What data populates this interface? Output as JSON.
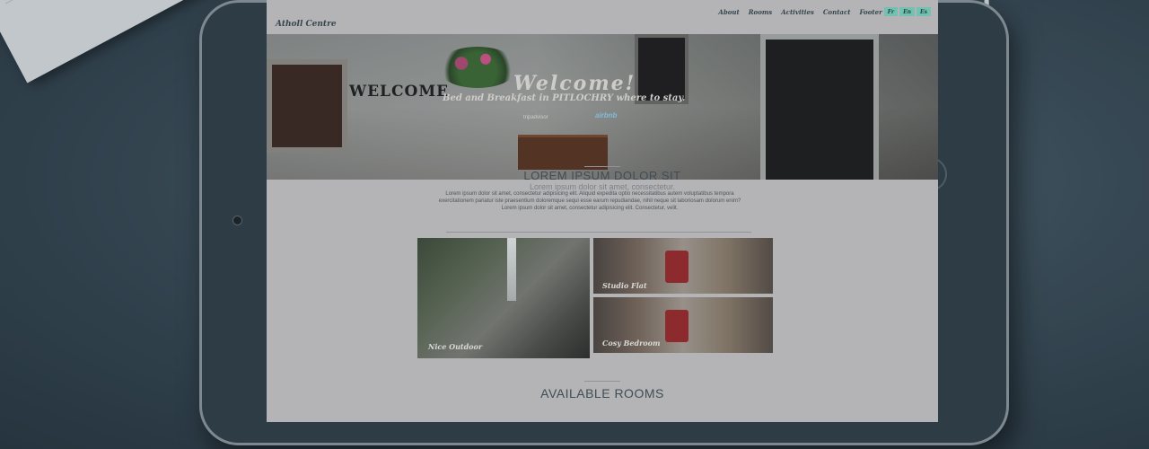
{
  "site": {
    "logo": "Atholl Centre",
    "nav": {
      "items": [
        "About",
        "Rooms",
        "Activities",
        "Contact",
        "Footer"
      ],
      "languages": [
        "Fr",
        "En",
        "Es"
      ]
    }
  },
  "hero": {
    "sign": "WELCOME",
    "title": "Welcome!",
    "subtitle": "Bed and Breakfast in PITLOCHRY where to stay.",
    "tripadvisor": "tripadvisor",
    "airbnb": "airbnb"
  },
  "intro": {
    "heading": "LOREM IPSUM DOLOR SIT",
    "subheading": "Lorem ipsum dolor sit amet, consectetur.",
    "body": "Lorem ipsum dolor sit amet, consectetur adipisicing elit. Aliquid expedita optio necessitatibus autem voluptatibus tempora exercitationem pariatur iste praesentium doloremque sequi esse earum repudiandae, nihil neque sit laboriosam dolorum enim? Lorem ipsum dolor sit amet, consectetur adipisicing elit. Consectetur, velit."
  },
  "gallery": {
    "items": [
      {
        "caption": "Nice Outdoor"
      },
      {
        "caption": "Studio Flat"
      },
      {
        "caption": "Cosy Bedroom"
      }
    ]
  },
  "rooms": {
    "heading": "AVAILABLE ROOMS"
  }
}
